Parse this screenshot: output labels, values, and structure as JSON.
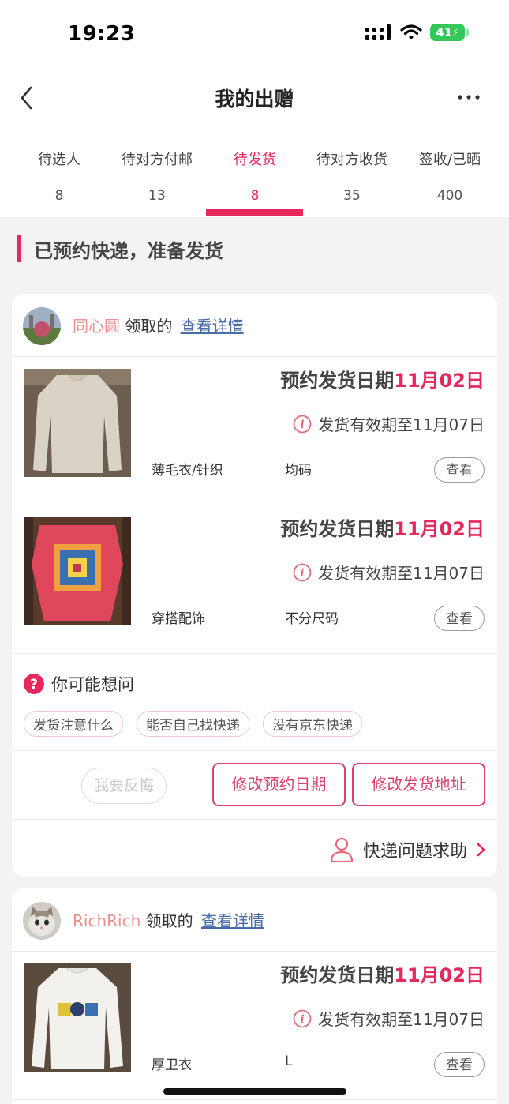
{
  "status_bar": {
    "time": "19:23",
    "battery": "41"
  },
  "nav": {
    "title": "我的出赠"
  },
  "tabs": [
    {
      "label": "待选人",
      "count": "8"
    },
    {
      "label": "待对方付邮",
      "count": "13"
    },
    {
      "label": "待发货",
      "count": "8"
    },
    {
      "label": "待对方收货",
      "count": "35"
    },
    {
      "label": "签收/已晒",
      "count": "400"
    }
  ],
  "active_tab": "待发货",
  "section_title": "已预约快递，准备发货",
  "cards": [
    {
      "username": "同心圆",
      "received_text": "领取的",
      "detail_link": "查看详情",
      "items": [
        {
          "date_prefix": "预约发货日期",
          "date_value": "11月02日",
          "valid_text": "发货有效期至11月07日",
          "category": "薄毛衣/针织",
          "size": "均码",
          "view_label": "查看"
        },
        {
          "date_prefix": "预约发货日期",
          "date_value": "11月02日",
          "valid_text": "发货有效期至11月07日",
          "category": "穿搭配饰",
          "size": "不分尺码",
          "view_label": "查看"
        }
      ],
      "faq_title": "你可能想问",
      "faq_chips": [
        "发货注意什么",
        "能否自己找快递",
        "没有京东快递"
      ],
      "regret_label": "我要反悔",
      "modify_date_label": "修改预约日期",
      "modify_address_label": "修改发货地址",
      "help_label": "快递问题求助"
    },
    {
      "username": "RichRich",
      "received_text": "领取的",
      "detail_link": "查看详情",
      "items": [
        {
          "date_prefix": "预约发货日期",
          "date_value": "11月02日",
          "valid_text": "发货有效期至11月07日",
          "category": "厚卫衣",
          "size": "L",
          "view_label": "查看"
        }
      ]
    }
  ],
  "colors": {
    "accent": "#e5285d",
    "link": "#4a6da8",
    "username": "#ee8e8e"
  }
}
